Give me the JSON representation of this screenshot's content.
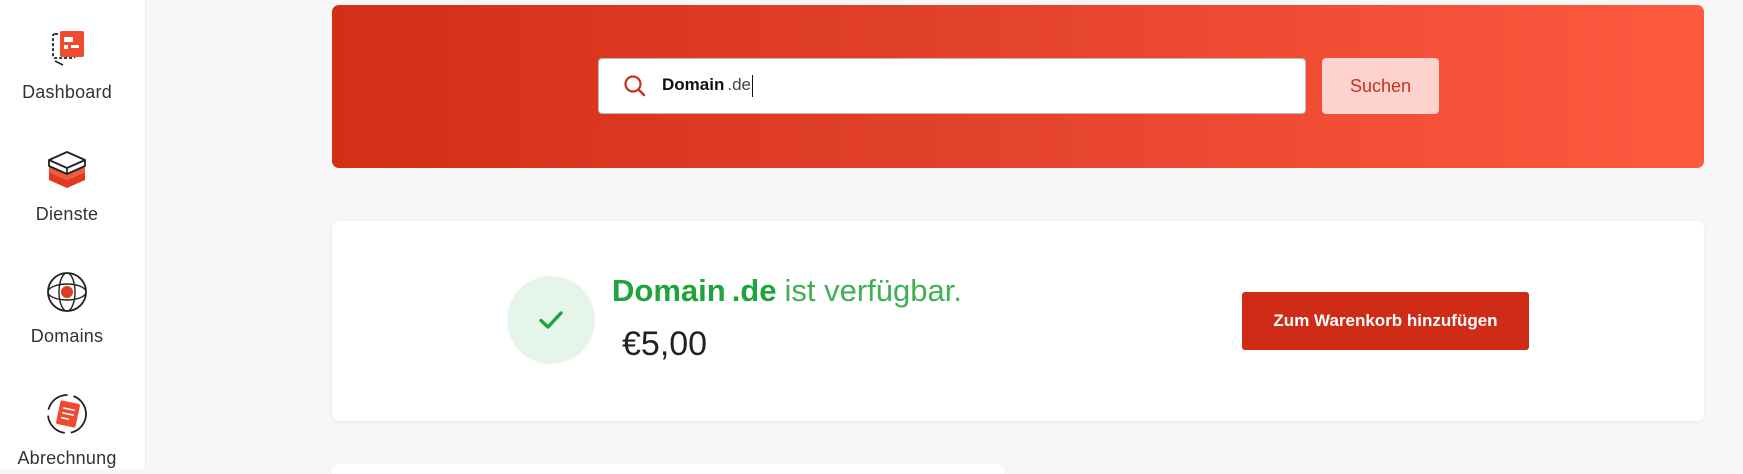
{
  "sidebar": {
    "items": [
      {
        "label": "Dashboard",
        "icon": "dashboard-icon"
      },
      {
        "label": "Dienste",
        "icon": "services-stack-icon"
      },
      {
        "label": "Domains",
        "icon": "globe-icon"
      },
      {
        "label": "Abrechnung",
        "icon": "billing-icon"
      }
    ]
  },
  "search": {
    "query_sld": "Domain",
    "query_tld": ".de",
    "button_label": "Suchen"
  },
  "result": {
    "domain_sld": "Domain",
    "domain_tld": ".de",
    "status_text": "ist verfügbar.",
    "price": "€5,00",
    "cart_button_label": "Zum Warenkorb hinzufügen"
  },
  "colors": {
    "brand_red": "#cf2c18",
    "available_green": "#1ea43c",
    "hero_gradient_start": "#d32f17",
    "hero_gradient_end": "#ff5a40"
  }
}
